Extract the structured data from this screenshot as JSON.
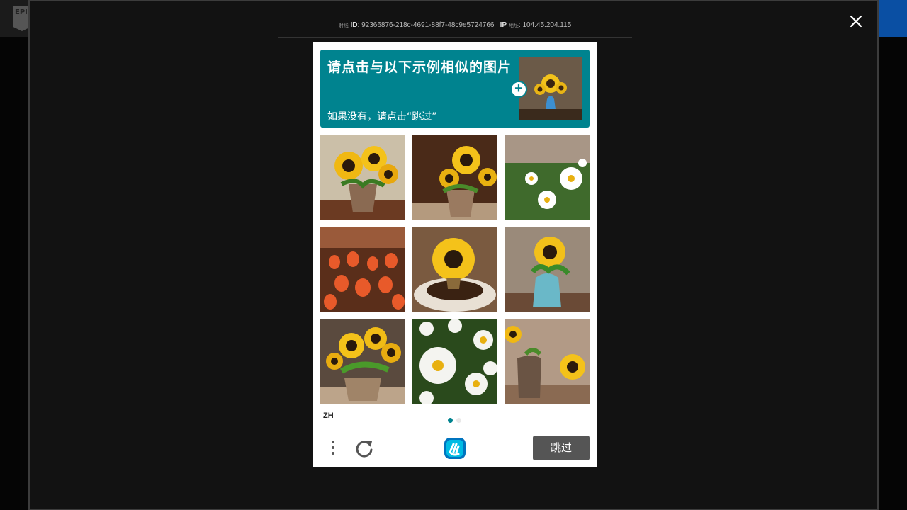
{
  "background": {
    "logo_text": "EPIC",
    "accent_color": "#0a4fa3"
  },
  "overlay": {
    "ray_label_small": "射线",
    "ray_label": "ID",
    "ray_id": "92366876-218c-4691-88f7-48c9e5724766",
    "separator": "|",
    "ip_label": "IP",
    "ip_label_small": "地址",
    "ip_value": "104.45.204.115",
    "close_icon": "close-icon"
  },
  "captcha": {
    "prompt_title": "请点击与以下示例相似的图片",
    "prompt_subtitle": "如果没有，请点击“跳过”",
    "prompt_color": "#00838f",
    "example_image": "sunflower-in-blue-vase",
    "tiles": [
      {
        "subject": "sunflowers in clay pot"
      },
      {
        "subject": "sunflowers in clay pot"
      },
      {
        "subject": "daisies in field"
      },
      {
        "subject": "red tulips field"
      },
      {
        "subject": "sunflower in white bowl"
      },
      {
        "subject": "sunflower in blue vase"
      },
      {
        "subject": "sunflowers in pot"
      },
      {
        "subject": "white daisies"
      },
      {
        "subject": "sunflower beside vase"
      }
    ],
    "language": "ZH",
    "page_indicator": {
      "current": 1,
      "total": 2
    },
    "menu_icon": "more-vertical-icon",
    "refresh_icon": "refresh-icon",
    "brand_icon": "hcaptcha-logo-icon",
    "verify_label": "跳过"
  }
}
